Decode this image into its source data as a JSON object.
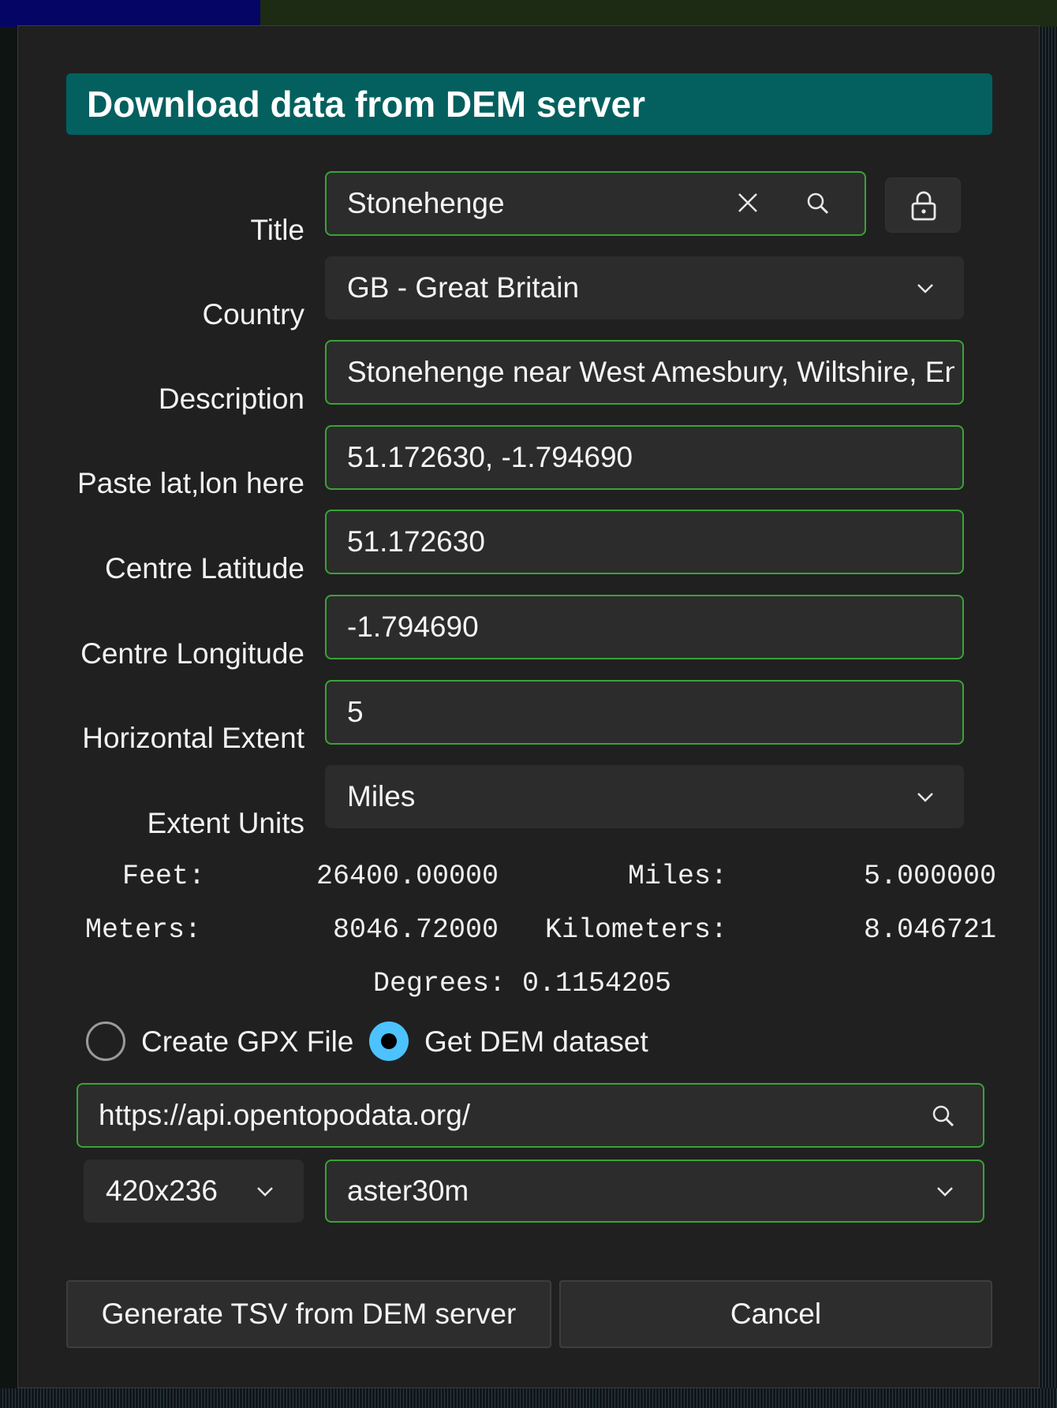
{
  "dialog": {
    "title": "Download data from DEM server"
  },
  "form": {
    "title_label": "Title",
    "title_value": "Stonehenge",
    "country_label": "Country",
    "country_value": "GB - Great Britain",
    "description_label": "Description",
    "description_value": "Stonehenge near West Amesbury, Wiltshire, England",
    "paste_label": "Paste lat,lon here",
    "paste_value": "51.172630, -1.794690",
    "lat_label": "Centre Latitude",
    "lat_value": "51.172630",
    "lon_label": "Centre Longitude",
    "lon_value": "-1.794690",
    "extent_label": "Horizontal Extent",
    "extent_value": "5",
    "units_label": "Extent Units",
    "units_value": "Miles"
  },
  "conversions": {
    "feet_label": "Feet:",
    "feet_value": "26400.00000",
    "miles_label": "Miles:",
    "miles_value": "5.000000",
    "meters_label": "Meters:",
    "meters_value": "8046.72000",
    "km_label": "Kilometers:",
    "km_value": "8.046721",
    "degrees_text": "Degrees: 0.1154205"
  },
  "mode": {
    "gpx_label": "Create GPX File",
    "gpx_selected": false,
    "dem_label": "Get DEM dataset",
    "dem_selected": true
  },
  "server": {
    "url": "https://api.opentopodata.org/",
    "size_value": "420x236",
    "dataset_value": "aster30m"
  },
  "actions": {
    "generate_label": "Generate TSV from DEM server",
    "cancel_label": "Cancel"
  },
  "colors": {
    "header_bg": "#03605f",
    "accent_border": "#3aa336",
    "radio_accent": "#4cc2ff"
  },
  "icons": [
    "clear-icon",
    "search-icon",
    "lock-icon",
    "chevron-down-icon"
  ]
}
